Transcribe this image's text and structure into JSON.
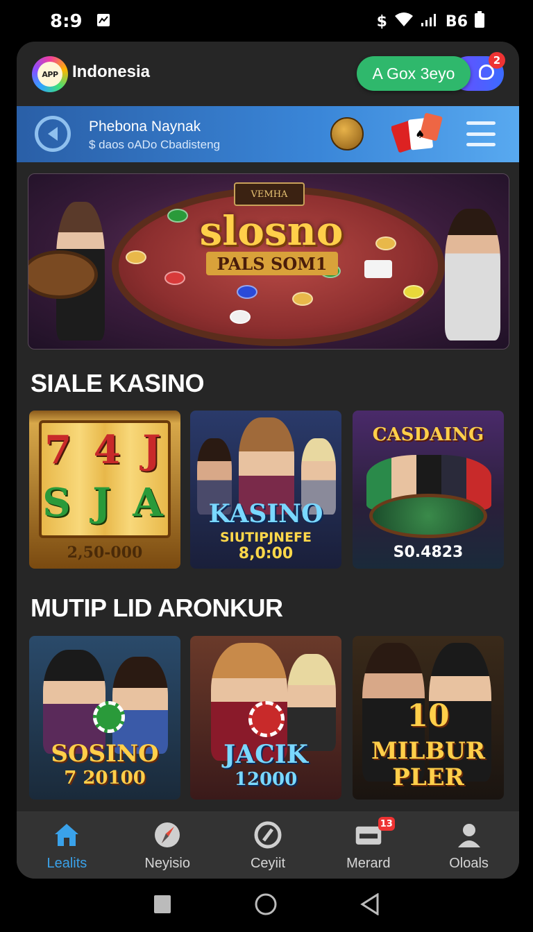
{
  "status_bar": {
    "time": "8:9",
    "carrier": "$",
    "battery_text": "B6"
  },
  "header": {
    "logo_text": "APP",
    "app_name": "Indonesia",
    "cta_label": "A Gox 3eyo",
    "notif_count": "2"
  },
  "promo": {
    "title": "Phebona Naynak",
    "subtitle": "$ daos oADo Cbadisteng"
  },
  "hero": {
    "badge": "VEMHA",
    "title": "slosno",
    "subtitle": "PALS SOM1"
  },
  "sections": [
    {
      "title": "SIALE KASINO",
      "tiles": [
        {
          "name": "slot-machine",
          "lines": [
            "7 4 J",
            "S J A"
          ],
          "amount": "2,50-000"
        },
        {
          "name": "kasino",
          "headline": "KASINO",
          "sub": "SIUTIPJNEFE",
          "amount": "8,0:00"
        },
        {
          "name": "casdaing",
          "headline": "CASDAING",
          "amount": "S0.4823"
        }
      ]
    },
    {
      "title": "MUTIP LID ARONKUR",
      "tiles": [
        {
          "name": "sosino",
          "headline": "SOSINO",
          "amount": "7 20100"
        },
        {
          "name": "jacik",
          "headline": "JACIK",
          "amount": "12000"
        },
        {
          "name": "milbur",
          "badge": "10",
          "headline": "MILBUR",
          "sub": "PLER"
        }
      ]
    }
  ],
  "bottom_nav": [
    {
      "label": "Lealits",
      "icon": "home-icon",
      "active": true
    },
    {
      "label": "Neyisio",
      "icon": "compass-icon"
    },
    {
      "label": "Ceyiit",
      "icon": "refresh-icon"
    },
    {
      "label": "Merard",
      "icon": "wallet-icon",
      "badge": "13"
    },
    {
      "label": "Oloals",
      "icon": "profile-icon"
    }
  ],
  "colors": {
    "accent": "#3aa2ea",
    "cta": "#2fb86c",
    "promo": "#3a86d8",
    "badge": "#e33333",
    "gold": "#ffcf4a"
  }
}
